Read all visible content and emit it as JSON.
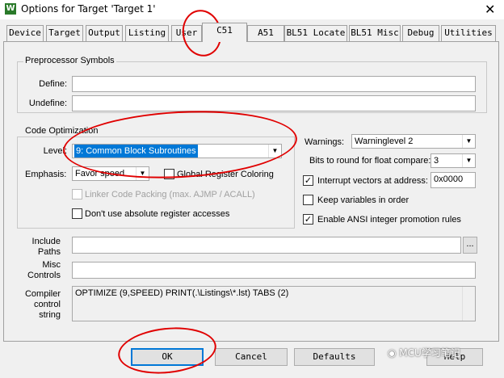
{
  "window": {
    "title": "Options for Target 'Target 1'",
    "close_glyph": "✕",
    "app_icon_letter": "W"
  },
  "tabs": [
    {
      "label": "Device"
    },
    {
      "label": "Target"
    },
    {
      "label": "Output"
    },
    {
      "label": "Listing"
    },
    {
      "label": "User"
    },
    {
      "label": "C51",
      "active": true
    },
    {
      "label": "A51"
    },
    {
      "label": "BL51 Locate"
    },
    {
      "label": "BL51 Misc"
    },
    {
      "label": "Debug"
    },
    {
      "label": "Utilities"
    }
  ],
  "preprocessor": {
    "group_label": "Preprocessor Symbols",
    "define_label": "Define:",
    "define_value": "",
    "undefine_label": "Undefine:",
    "undefine_value": ""
  },
  "code_optimization": {
    "group_label": "Code Optimization",
    "level_label": "Level:",
    "level_value": "9: Common Block Subroutines",
    "emphasis_label": "Emphasis:",
    "emphasis_value": "Favor speed",
    "global_register_coloring": {
      "label": "Global Register Coloring",
      "checked": false
    },
    "linker_code_packing": {
      "label": "Linker Code Packing (max. AJMP / ACALL)",
      "checked": false,
      "disabled": true
    },
    "no_absolute_register": {
      "label": "Don't use absolute register accesses",
      "checked": false
    }
  },
  "warnings": {
    "label": "Warnings:",
    "value": "Warninglevel 2",
    "bits_label": "Bits to round for float compare:",
    "bits_value": "3",
    "interrupt_vectors": {
      "label": "Interrupt vectors at address:",
      "checked": true,
      "value": "0x0000"
    },
    "keep_variables": {
      "label": "Keep variables in order",
      "checked": false
    },
    "ansi_promotion": {
      "label": "Enable ANSI integer promotion rules",
      "checked": true
    }
  },
  "paths": {
    "include_label": "Include\nPaths",
    "include_value": "",
    "misc_label": "Misc\nControls",
    "misc_value": "",
    "browse_label": "...",
    "compiler_label": "Compiler\ncontrol\nstring",
    "compiler_value": "OPTIMIZE (9,SPEED) PRINT(.\\Listings\\*.lst) TABS (2)"
  },
  "buttons": {
    "ok": "OK",
    "cancel": "Cancel",
    "defaults": "Defaults",
    "help": "Help"
  },
  "watermark": "MCU学习笔记",
  "colors": {
    "highlight": "#0078d7",
    "annotation_red": "#e00000"
  }
}
